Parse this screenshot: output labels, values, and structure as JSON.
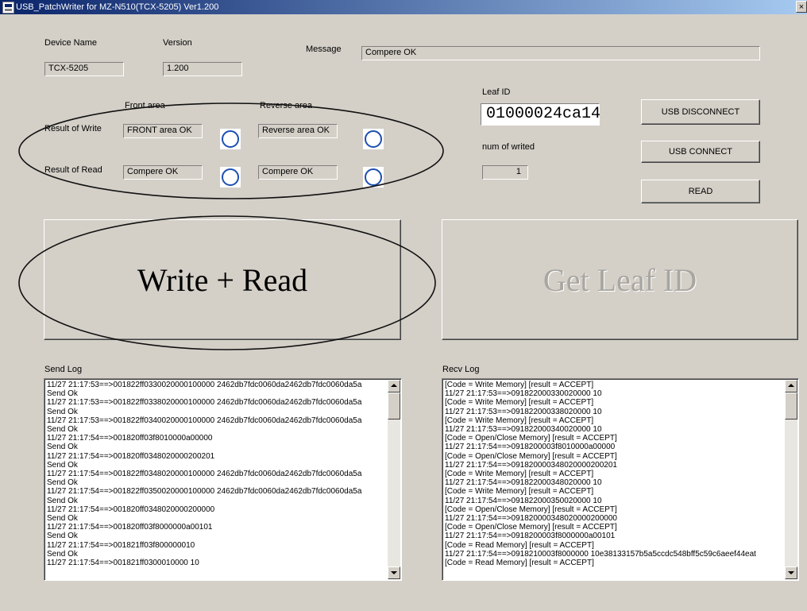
{
  "window": {
    "title": "USB_PatchWriter for MZ-N510(TCX-5205) Ver1.200",
    "close_glyph": "×"
  },
  "device": {
    "name_label": "Device Name",
    "name_value": "TCX-5205",
    "version_label": "Version",
    "version_value": "1.200"
  },
  "message": {
    "label": "Message",
    "value": "Compere OK"
  },
  "areas": {
    "front_label": "Front area",
    "reverse_label": "Reverse area"
  },
  "results": {
    "write": {
      "label": "Result of Write",
      "front": "FRONT area OK",
      "reverse": "Reverse area OK"
    },
    "read": {
      "label": "Result of Read",
      "front": "Compere OK",
      "reverse": "Compere OK"
    }
  },
  "leaf": {
    "label": "Leaf ID",
    "value": "01000024ca14",
    "count_label": "num of writed",
    "count_value": "1"
  },
  "buttons": {
    "disconnect": "USB DISCONNECT",
    "connect": "USB CONNECT",
    "read": "READ",
    "write_read": "Write + Read",
    "get_leaf": "Get Leaf ID"
  },
  "send_log": {
    "label": "Send Log",
    "lines": [
      "11/27 21:17:53==>001822ff0330020000100000 2462db7fdc0060da2462db7fdc0060da5a",
      "Send Ok",
      "11/27 21:17:53==>001822ff0338020000100000 2462db7fdc0060da2462db7fdc0060da5a",
      "Send Ok",
      "11/27 21:17:53==>001822ff0340020000100000 2462db7fdc0060da2462db7fdc0060da5a",
      "Send Ok",
      "11/27 21:17:54==>001820ff03f8010000a00000",
      "Send Ok",
      "11/27 21:17:54==>001820ff0348020000200201",
      "Send Ok",
      "11/27 21:17:54==>001822ff0348020000100000 2462db7fdc0060da2462db7fdc0060da5a",
      "Send Ok",
      "11/27 21:17:54==>001822ff0350020000100000 2462db7fdc0060da2462db7fdc0060da5a",
      "Send Ok",
      "11/27 21:17:54==>001820ff0348020000200000",
      "Send Ok",
      "11/27 21:17:54==>001820ff03f8000000a00101",
      "Send Ok",
      "11/27 21:17:54==>001821ff03f800000010",
      "Send Ok",
      "11/27 21:17:54==>001821ff0300010000 10"
    ]
  },
  "recv_log": {
    "label": "Recv Log",
    "lines": [
      "[Code = Write Memory]  [result = ACCEPT]",
      "11/27 21:17:53==>091822000330020000 10",
      "[Code = Write Memory]  [result = ACCEPT]",
      "11/27 21:17:53==>091822000338020000 10",
      "[Code = Write Memory]  [result = ACCEPT]",
      "11/27 21:17:53==>091822000340020000 10",
      "[Code = Open/Close Memory]  [result = ACCEPT]",
      "11/27 21:17:54==>0918200003f8010000a00000",
      "[Code = Open/Close Memory]  [result = ACCEPT]",
      "11/27 21:17:54==>091820000348020000200201",
      "[Code = Write Memory]  [result = ACCEPT]",
      "11/27 21:17:54==>091822000348020000 10",
      "[Code = Write Memory]  [result = ACCEPT]",
      "11/27 21:17:54==>091822000350020000 10",
      "[Code = Open/Close Memory]  [result = ACCEPT]",
      "11/27 21:17:54==>091820000348020000200000",
      "[Code = Open/Close Memory]  [result = ACCEPT]",
      "11/27 21:17:54==>0918200003f8000000a00101",
      "[Code = Read Memory]  [result = ACCEPT]",
      "11/27 21:17:54==>0918210003f8000000 10e38133157b5a5ccdc548bff5c59c6aeef44eat",
      "[Code = Read Memory]  [result = ACCEPT]"
    ]
  }
}
